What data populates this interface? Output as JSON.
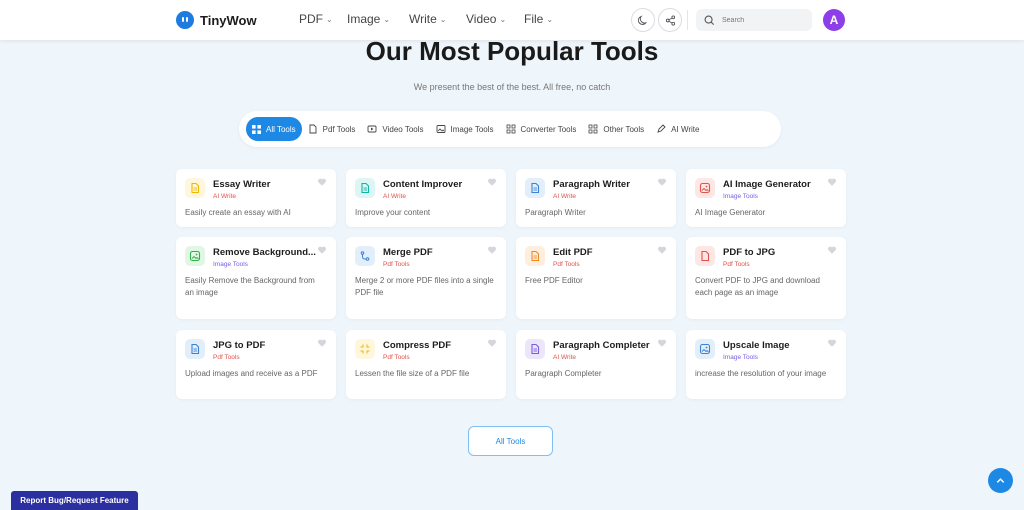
{
  "header": {
    "logo_text": "TinyWow",
    "nav": [
      {
        "label": "PDF"
      },
      {
        "label": "Image"
      },
      {
        "label": "Write"
      },
      {
        "label": "Video"
      },
      {
        "label": "File"
      }
    ],
    "search_placeholder": "Search",
    "avatar_letter": "A"
  },
  "main": {
    "title": "Our Most Popular Tools",
    "subtitle": "We present the best of the best. All free, no catch",
    "tabs": [
      {
        "label": "All Tools",
        "icon": "grid-icon",
        "active": true
      },
      {
        "label": "Pdf Tools",
        "icon": "pdf-file-icon",
        "active": false
      },
      {
        "label": "Video Tools",
        "icon": "video-icon",
        "active": false
      },
      {
        "label": "Image Tools",
        "icon": "image-icon",
        "active": false
      },
      {
        "label": "Converter Tools",
        "icon": "converter-grid-icon",
        "active": false
      },
      {
        "label": "Other Tools",
        "icon": "apps-grid-icon",
        "active": false
      },
      {
        "label": "AI Write",
        "icon": "pen-icon",
        "active": false
      }
    ],
    "tools": [
      {
        "name": "Essay Writer",
        "category": "AI Write",
        "description": "Easily create an essay with AI",
        "icon": "document-icon",
        "icon_color": "#f4b400",
        "icon_bg": "#fff7dc"
      },
      {
        "name": "Content Improver",
        "category": "AI Write",
        "description": "Improve your content",
        "icon": "document-icon",
        "icon_color": "#12b5a4",
        "icon_bg": "#ddf6f3"
      },
      {
        "name": "Paragraph Writer",
        "category": "AI Write",
        "description": "Paragraph Writer",
        "icon": "document-icon",
        "icon_color": "#3b82d6",
        "icon_bg": "#e3eefb"
      },
      {
        "name": "AI Image Generator",
        "category": "Image Tools",
        "description": "AI Image Generator",
        "icon": "image-icon",
        "icon_color": "#e0524a",
        "icon_bg": "#fde6e4"
      },
      {
        "name": "Remove Background...",
        "category": "Image Tools",
        "description": "Easily Remove the Background from an image",
        "icon": "image-icon",
        "icon_color": "#2fb14a",
        "icon_bg": "#e2f6e6"
      },
      {
        "name": "Merge PDF",
        "category": "Pdf Tools",
        "description": "Merge 2 or more PDF files into a single PDF file",
        "icon": "merge-icon",
        "icon_color": "#3b82d6",
        "icon_bg": "#e3eefb"
      },
      {
        "name": "Edit PDF",
        "category": "Pdf Tools",
        "description": "Free PDF Editor",
        "icon": "document-icon",
        "icon_color": "#f08a24",
        "icon_bg": "#fdeedd"
      },
      {
        "name": "PDF to JPG",
        "category": "Pdf Tools",
        "description": "Convert PDF to JPG and download each page as an image",
        "icon": "pdf-file-icon",
        "icon_color": "#e0524a",
        "icon_bg": "#fde6e4"
      },
      {
        "name": "JPG to PDF",
        "category": "Pdf Tools",
        "description": "Upload images and receive as a PDF",
        "icon": "document-icon",
        "icon_color": "#3b82d6",
        "icon_bg": "#e3eefb"
      },
      {
        "name": "Compress PDF",
        "category": "Pdf Tools",
        "description": "Lessen the file size of a PDF file",
        "icon": "compress-icon",
        "icon_color": "#f4b400",
        "icon_bg": "#fff7dc"
      },
      {
        "name": "Paragraph Completer",
        "category": "AI Write",
        "description": "Paragraph Completer",
        "icon": "document-icon",
        "icon_color": "#7a5ce6",
        "icon_bg": "#ece6fb"
      },
      {
        "name": "Upscale Image",
        "category": "Image Tools",
        "description": "increase the resolution of your image",
        "icon": "image-icon",
        "icon_color": "#3b82d6",
        "icon_bg": "#e3eefb"
      }
    ],
    "all_tools_button": "All Tools"
  },
  "footer": {
    "report_button": "Report Bug/Request Feature"
  },
  "colors": {
    "accent": "#1e88e5",
    "background": "#eef5fb",
    "report_button_bg": "#2b2fa0",
    "avatar_bg": "#8d3ee8"
  }
}
